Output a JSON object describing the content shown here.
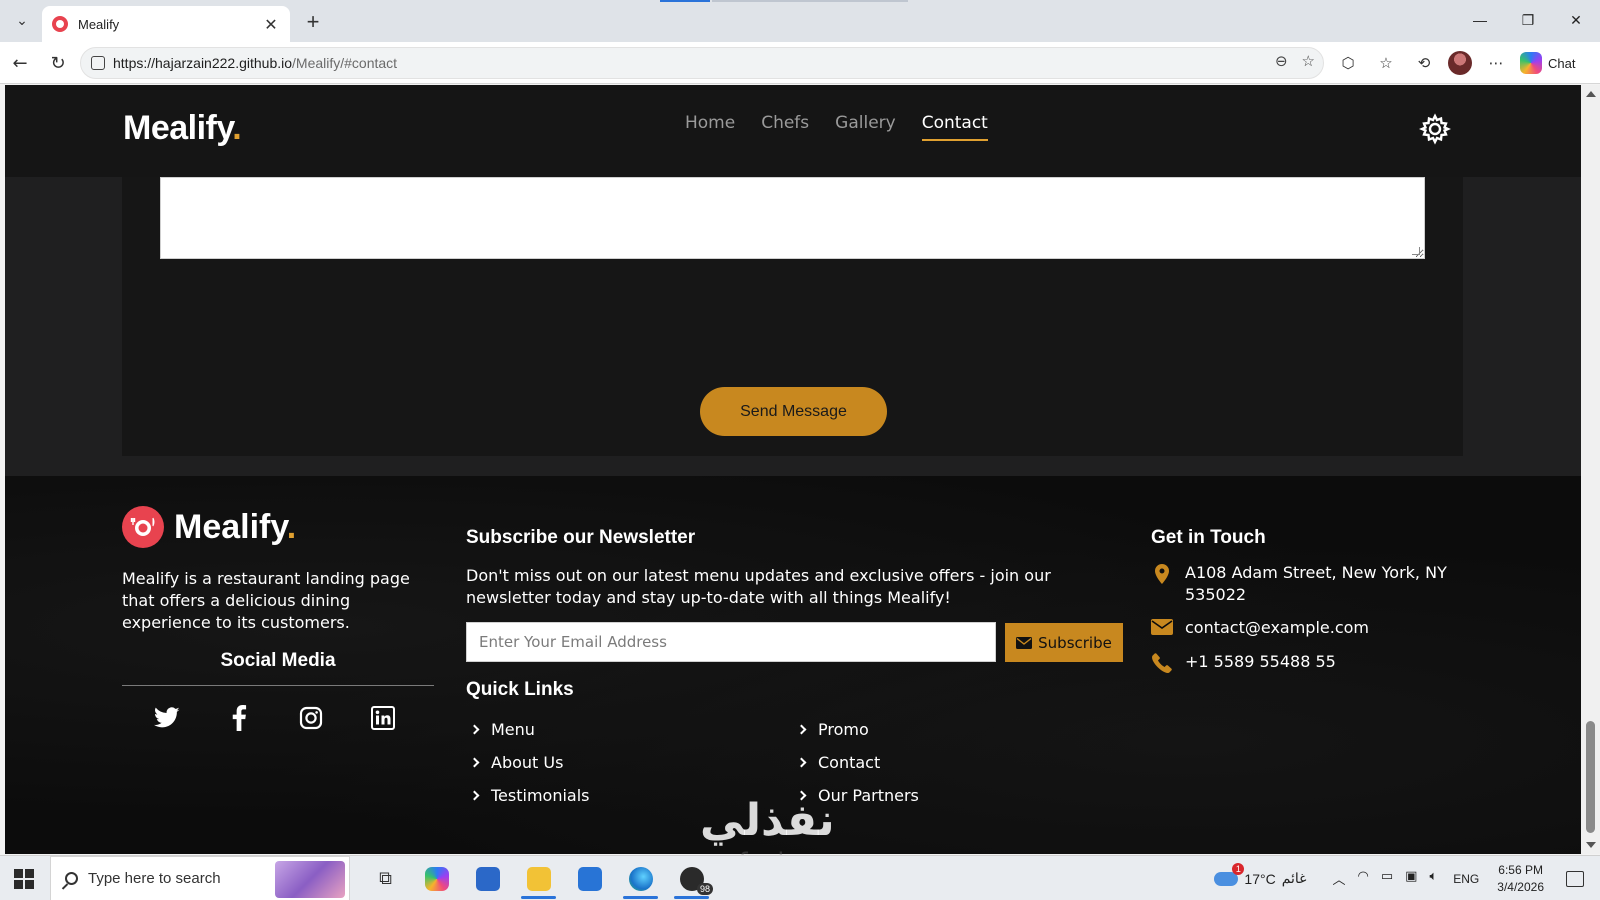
{
  "browser": {
    "tab_title": "Mealify",
    "tab_close": "✕",
    "new_tab": "+",
    "url_host": "https://hajarzain222.github.io",
    "url_path": "/Mealify/#contact",
    "chat_label": "Chat",
    "window_controls": [
      "—",
      "❐",
      "✕"
    ]
  },
  "site": {
    "logo": "Mealify",
    "logo_dot": ".",
    "nav": [
      {
        "label": "Home",
        "active": false
      },
      {
        "label": "Chefs",
        "active": false
      },
      {
        "label": "Gallery",
        "active": false
      },
      {
        "label": "Contact",
        "active": true
      }
    ]
  },
  "contact_form": {
    "message_value": "",
    "send_label": "Send Message"
  },
  "footer": {
    "brand": "Mealify",
    "brand_dot": ".",
    "description": "Mealify is a restaurant landing page that offers a delicious dining experience to its customers.",
    "social_title": "Social Media",
    "social_icons": [
      "twitter-icon",
      "facebook-icon",
      "instagram-icon",
      "linkedin-icon"
    ],
    "newsletter_title": "Subscribe our Newsletter",
    "newsletter_text": "Don't miss out on our latest menu updates and exclusive offers - join our newsletter today and stay up-to-date with all things Mealify!",
    "email_placeholder": "Enter Your Email Address",
    "subscribe_label": "Subscribe",
    "quick_links_title": "Quick Links",
    "quick_links_left": [
      "Menu",
      "About Us",
      "Testimonials"
    ],
    "quick_links_right": [
      "Promo",
      "Contact",
      "Our Partners"
    ],
    "touch_title": "Get in Touch",
    "address": "A108 Adam Street, New York, NY 535022",
    "email": "contact@example.com",
    "phone": "+1 5589 55488 55"
  },
  "watermark": {
    "text": "نفذلي",
    "url": "nafezly.com"
  },
  "taskbar": {
    "search_placeholder": "Type here to search",
    "whatsapp_badge": "98",
    "temperature": "17°C",
    "weather_text": "غائم",
    "language": "ENG",
    "time": "6:56 PM",
    "date": "3/4/2026"
  },
  "colors": {
    "accent": "#c8881f",
    "logo_dot": "#e0a030",
    "header_bg": "#151515",
    "footer_bg": "#0c0c0c",
    "brand_red": "#e8434f"
  }
}
